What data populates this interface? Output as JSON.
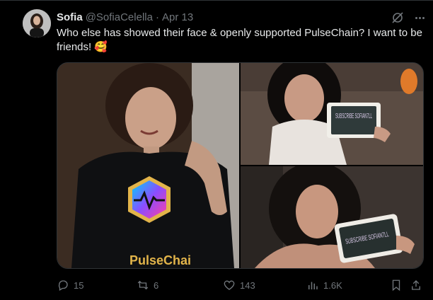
{
  "author": {
    "name": "Sofia",
    "handle": "@SofiaCelella",
    "separator": "·",
    "date": "Apr 13"
  },
  "tweet": {
    "text": "Who else has showed their face & openly supported PulseChain? I want to be friends! 🥰"
  },
  "media": {
    "photos": [
      {
        "label": "photo-1",
        "shirt_text": "PulseChai"
      },
      {
        "label": "photo-2",
        "sign_text": "SUBSCRIBE SOFIAN7LL"
      },
      {
        "label": "photo-3",
        "sign_text": "SUBSCRIBE SOFIAN7LL"
      }
    ]
  },
  "stats": {
    "replies": "15",
    "reposts": "6",
    "likes": "143",
    "views": "1.6K"
  },
  "colors": {
    "background": "#000000",
    "text_primary": "#e7e9ea",
    "text_secondary": "#71767b",
    "border": "#2f3336"
  }
}
